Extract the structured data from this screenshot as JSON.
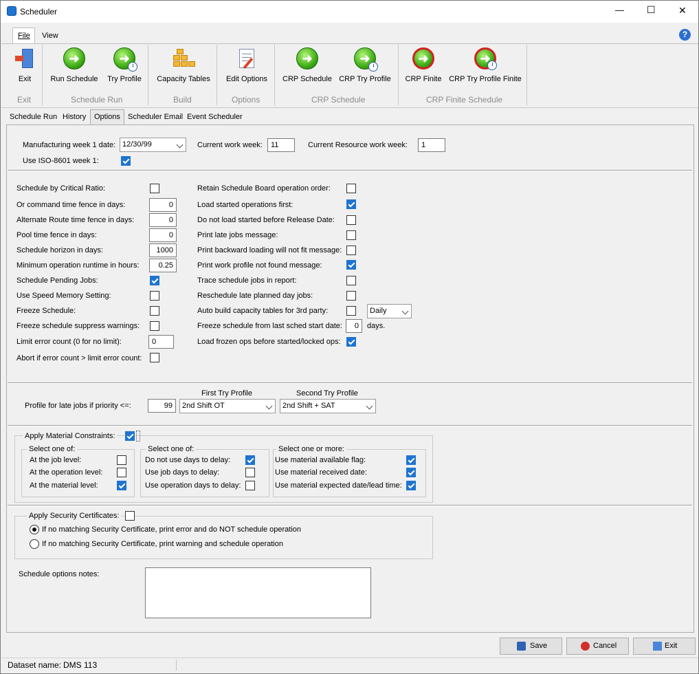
{
  "window": {
    "title": "Scheduler",
    "minimize": "—",
    "maximize": "☐",
    "close": "✕"
  },
  "menu": {
    "file": "File",
    "view": "View",
    "help": "?"
  },
  "ribbon": {
    "groups": {
      "exit": "Exit",
      "schedule_run": "Schedule Run",
      "build": "Build",
      "options": "Options",
      "crp_schedule": "CRP Schedule",
      "crp_finite": "CRP Finite Schedule"
    },
    "buttons": {
      "exit": "Exit",
      "run_schedule": "Run Schedule",
      "try_profile": "Try Profile",
      "capacity_tables": "Capacity Tables",
      "edit_options": "Edit Options",
      "crp_schedule": "CRP Schedule",
      "crp_try_profile": "CRP Try Profile",
      "crp_finite": "CRP Finite",
      "crp_try_profile_finite": "CRP Try Profile Finite"
    }
  },
  "tabs": [
    "Schedule Run",
    "History",
    "Options",
    "Scheduler Email",
    "Event Scheduler"
  ],
  "header": {
    "mfg_week_label": "Manufacturing week 1 date:",
    "mfg_week_value": "12/30/99",
    "current_week_label": "Current work week:",
    "current_week_value": "11",
    "resource_week_label": "Current Resource work week:",
    "resource_week_value": "1",
    "iso_label": "Use ISO-8601 week 1:",
    "iso_checked": true
  },
  "left_options": [
    {
      "label": "Schedule by Critical Ratio:",
      "type": "check",
      "checked": false
    },
    {
      "label": "Or command time fence in days:",
      "type": "num",
      "value": "0"
    },
    {
      "label": "Alternate Route time fence in days:",
      "type": "num",
      "value": "0"
    },
    {
      "label": "Pool time fence in days:",
      "type": "num",
      "value": "0"
    },
    {
      "label": "Schedule horizon in days:",
      "type": "num",
      "value": "1000"
    },
    {
      "label": "Minimum operation runtime in hours:",
      "type": "num",
      "value": "0.25"
    },
    {
      "label": "Schedule Pending Jobs:",
      "type": "check",
      "checked": true
    },
    {
      "label": "Use Speed Memory Setting:",
      "type": "check",
      "checked": false
    },
    {
      "label": "Freeze Schedule:",
      "type": "check",
      "checked": false
    },
    {
      "label": "Freeze schedule suppress warnings:",
      "type": "check",
      "checked": false
    },
    {
      "label": "Limit error count (0 for no limit):",
      "type": "text",
      "value": "0"
    },
    {
      "label": "Abort if error count > limit error count:",
      "type": "check",
      "checked": false
    }
  ],
  "right_options": [
    {
      "label": "Retain Schedule Board operation order:",
      "checked": false
    },
    {
      "label": "Load started operations first:",
      "checked": true
    },
    {
      "label": "Do not load started before Release Date:",
      "checked": false
    },
    {
      "label": "Print late jobs message:",
      "checked": false
    },
    {
      "label": "Print backward loading will not fit message:",
      "checked": false
    },
    {
      "label": "Print work profile not found message:",
      "checked": true
    },
    {
      "label": "Trace schedule jobs in report:",
      "checked": false
    },
    {
      "label": "Reschedule late planned day jobs:",
      "checked": false
    },
    {
      "label": "Auto build capacity tables for 3rd party:",
      "checked": false
    },
    {
      "label": "Freeze schedule from last sched start date:",
      "checked": false
    },
    {
      "label": "Load frozen ops before started/locked ops:",
      "checked": true
    }
  ],
  "auto_build_frequency": "Daily",
  "freeze_days_value": "0",
  "freeze_days_unit": "days.",
  "profile": {
    "label": "Profile for late jobs if priority <=:",
    "priority": "99",
    "first_header": "First Try Profile",
    "first_value": "2nd Shift OT",
    "second_header": "Second Try Profile",
    "second_value": "2nd Shift + SAT"
  },
  "material": {
    "label": "Apply Material Constraints:",
    "checked": true,
    "group1": {
      "title": "Select one of:",
      "items": [
        {
          "label": "At the job level:",
          "checked": false
        },
        {
          "label": "At the operation level:",
          "checked": false
        },
        {
          "label": "At the material level:",
          "checked": true
        }
      ]
    },
    "group2": {
      "title": "Select one of:",
      "items": [
        {
          "label": "Do not use days to delay:",
          "checked": true
        },
        {
          "label": "Use job days to delay:",
          "checked": false
        },
        {
          "label": "Use operation days to delay:",
          "checked": false
        }
      ]
    },
    "group3": {
      "title": "Select one or more:",
      "items": [
        {
          "label": "Use material available flag:",
          "checked": true
        },
        {
          "label": "Use material received date:",
          "checked": true
        },
        {
          "label": "Use material expected date/lead time:",
          "checked": true
        }
      ]
    }
  },
  "security": {
    "label": "Apply Security Certificates:",
    "checked": false,
    "radio1": "If no matching Security Certificate, print error and do NOT schedule operation",
    "radio2": "If no matching Security Certificate, print warning and schedule operation",
    "selected": 1
  },
  "notes": {
    "label": "Schedule options notes:",
    "value": ""
  },
  "footer": {
    "save": "Save",
    "cancel": "Cancel",
    "exit": "Exit"
  },
  "status": {
    "dataset_label": "Dataset name:",
    "dataset_value": "DMS 113"
  }
}
